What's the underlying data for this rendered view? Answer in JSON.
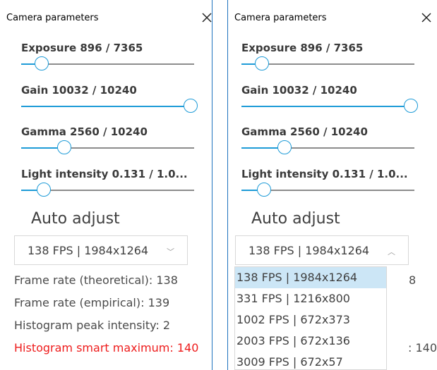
{
  "title": "Camera parameters",
  "close_symbol": "✕",
  "params": [
    {
      "label": "Exposure 896 / 7365",
      "level": 0.12
    },
    {
      "label": "Gain 10032 / 10240",
      "level": 0.98
    },
    {
      "label": "Gamma 2560 / 10240",
      "level": 0.25
    },
    {
      "label": "Light intensity 0.131 / 1.0...",
      "level": 0.13
    }
  ],
  "auto_adjust": "Auto adjust",
  "select": {
    "value": "138 FPS | 1984x1264",
    "arrow_closed": "﹀",
    "arrow_open": "︿"
  },
  "info": {
    "frame_rate_theoretical": "Frame rate (theoretical): 138",
    "frame_rate_empirical": "Frame rate (empirical): 139",
    "histogram_peak": "Histogram peak intensity: 2",
    "histogram_smart_max": "Histogram smart maximum: 140"
  },
  "right_partial": {
    "theoretical_tail": "8",
    "smart_max_tail": ": 140"
  },
  "dropdown_options": [
    "138 FPS | 1984x1264",
    "331 FPS | 1216x800",
    "1002 FPS | 672x373",
    "2003 FPS | 672x136",
    "3009 FPS | 672x57"
  ],
  "dropdown_selected_index": 0,
  "colors": {
    "accent": "#1e9bd7",
    "warning": "#ee1c1c",
    "selected_bg": "#cce6f6"
  },
  "icons": {
    "close": "close-icon",
    "chevron_down": "chevron-down-icon",
    "chevron_up": "chevron-up-icon"
  }
}
